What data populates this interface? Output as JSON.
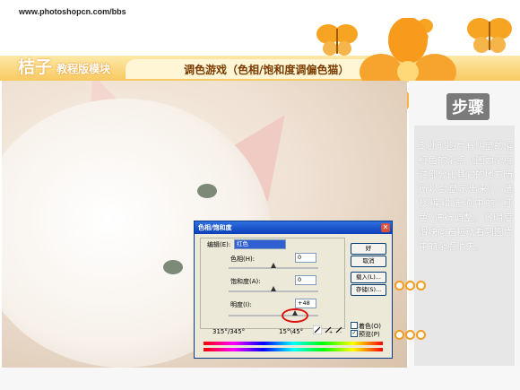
{
  "header": {
    "url": "www.photoshopcn.com/bbs",
    "brand_big": "桔子",
    "brand_small": "教程版模块",
    "title": "调色游戏（色相/饱和度调偏色猫）"
  },
  "side": {
    "step_label": "步骤",
    "instruction": "3.此时图片有明显的偏红色的杂点（因为杂点这部分比其它的地方暗所以会显示出来），选择编辑选项中的“红色”进行调整。将明度滑块向右拉动看到图片中的杂点消失。"
  },
  "dialog": {
    "title": "色相/饱和度",
    "close_glyph": "✕",
    "edit_label": "编辑(E):",
    "edit_value": "红色",
    "hue_label": "色相(H):",
    "hue_value": "0",
    "sat_label": "饱和度(A):",
    "sat_value": "0",
    "light_label": "明度(I):",
    "light_value": "+48",
    "range_left": "315°/345°",
    "range_right": "15°\\45°",
    "buttons": {
      "ok": "好",
      "cancel": "取消",
      "load": "载入(L)...",
      "save": "存储(S)..."
    },
    "colorize_label": "着色(O)",
    "preview_label": "预览(P)",
    "preview_checked_glyph": "✓",
    "slider_levels": {
      "hue": 0,
      "saturation": 0,
      "lightness": 48
    }
  },
  "colors": {
    "accent_orange": "#f39c1e",
    "title_text": "#7a3b00",
    "highlight_red": "#dd1111"
  },
  "icons": [
    "butterfly-icon",
    "orange-flower-icon",
    "eyedropper-icon",
    "eyedropper-plus-icon",
    "eyedropper-minus-icon"
  ]
}
